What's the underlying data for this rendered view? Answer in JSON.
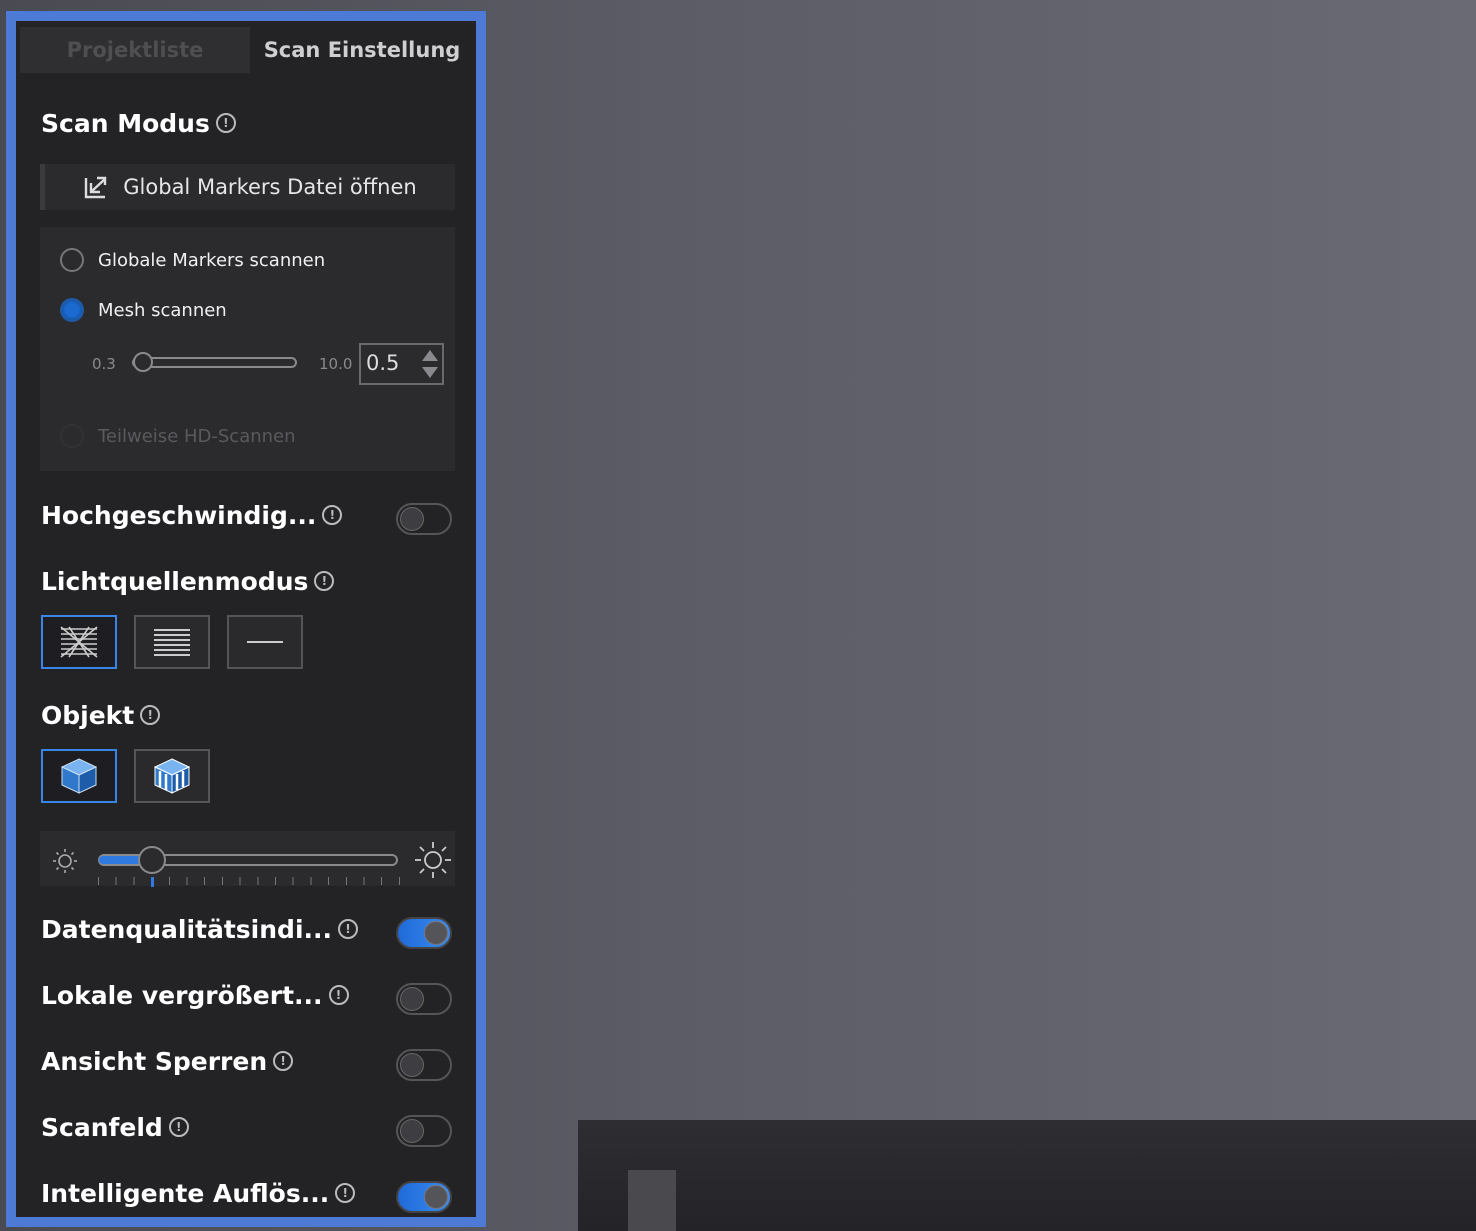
{
  "tabs": {
    "project_list": "Projektliste",
    "scan_settings": "Scan Einstellung"
  },
  "scan_mode": {
    "title": "Scan Modus",
    "open_file_label": "Global Markers Datei öffnen",
    "option_global_markers": "Globale Markers scannen",
    "option_mesh": "Mesh scannen",
    "resolution_min": "0.3",
    "resolution_max": "10.0",
    "resolution_value": "0.5",
    "partial_hd": "Teilweise HD-Scannen"
  },
  "high_speed": {
    "label": "Hochgeschwindig...",
    "on": false
  },
  "light_mode": {
    "title": "Lichtquellenmodus",
    "options": [
      "multi-line-icon",
      "parallel-lines-icon",
      "single-line-icon"
    ],
    "selected": 0
  },
  "object": {
    "title": "Objekt",
    "options": [
      "normal-object-icon",
      "dark-reflective-object-icon"
    ],
    "selected": 0
  },
  "brightness": {
    "level_fraction": 0.18
  },
  "toggles": {
    "data_quality": {
      "label": "Datenqualitätsindi...",
      "on": true
    },
    "local_zoom": {
      "label": "Lokale vergrößert...",
      "on": false
    },
    "lock_view": {
      "label": "Ansicht Sperren",
      "on": false
    },
    "scan_field": {
      "label": "Scanfeld",
      "on": false
    },
    "smart_resolution": {
      "label": "Intelligente Auflös...",
      "on": true
    }
  },
  "colors": {
    "accent": "#4c7ad4",
    "toggle_on": "#2e7ae0",
    "panel_bg": "#232326"
  }
}
